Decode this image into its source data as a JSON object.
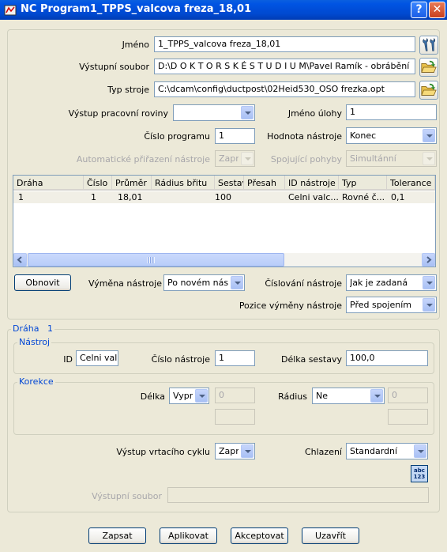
{
  "window": {
    "title": "NC Program1_TPPS_valcova freza_18,01",
    "help_label": "?",
    "close_label": "✕"
  },
  "form": {
    "name_label": "Jméno",
    "name_value": "1_TPPS_valcova freza_18,01",
    "output_file_label": "Výstupní soubor",
    "output_file_value": "D:\\D O K T O R S K É     S T U D I U M\\Pavel Ramík - obrábění",
    "machine_type_label": "Typ stroje",
    "machine_type_value": "C:\\dcam\\config\\ductpost\\02Heid530_OSO frezka.opt",
    "work_plane_label": "Výstup pracovní roviny",
    "work_plane_value": "",
    "task_name_label": "Jméno úlohy",
    "task_name_value": "1",
    "program_number_label": "Číslo programu",
    "program_number_value": "1",
    "tool_value_label": "Hodnota nástroje",
    "tool_value_value": "Konec",
    "auto_tool_assign_label": "Automatické přiřazení nástroje",
    "auto_tool_assign_value": "Zapnout",
    "connecting_moves_label": "Spojující pohyby",
    "connecting_moves_value": "Simultánní"
  },
  "table": {
    "columns": [
      "Dráha",
      "Číslo",
      "Průměr",
      "Rádius břitu",
      "Sestava",
      "Přesah",
      "ID nástroje",
      "Typ",
      "Tolerance"
    ],
    "rows": [
      [
        "1",
        "1",
        "18,01",
        "",
        "100",
        "",
        "Celni valc...",
        "Rovné č...",
        "0,1"
      ]
    ]
  },
  "actions": {
    "refresh_label": "Obnovit",
    "tool_change_label": "Výměna nástroje",
    "tool_change_value": "Po novém nástroji",
    "tool_numbering_label": "Číslování nástroje",
    "tool_numbering_value": "Jak je zadaná",
    "tool_change_position_label": "Pozice výměny nástroje",
    "tool_change_position_value": "Před spojením"
  },
  "path": {
    "group_label": "Dráha",
    "group_number": "1",
    "tool_group_label": "Nástroj",
    "id_label": "ID",
    "id_value": "Celni valc",
    "tool_number_label": "Číslo nástroje",
    "tool_number_value": "1",
    "assembly_length_label": "Délka sestavy",
    "assembly_length_value": "100,0",
    "correction_group_label": "Korekce",
    "length_label": "Délka",
    "length_mode_value": "Vypnout",
    "length_value": "0",
    "length_extra_value": "",
    "radius_label": "Rádius",
    "radius_mode_value": "Ne",
    "radius_value": "0",
    "radius_extra_value": "",
    "drill_cycle_label": "Výstup vrtacího cyklu",
    "drill_cycle_value": "Zapnout",
    "coolant_label": "Chlazení",
    "coolant_value": "Standardní",
    "spell_icon_text": "abc 123",
    "output_file_label": "Výstupní soubor",
    "output_file_value": ""
  },
  "footer": {
    "write_label": "Zapsat",
    "apply_label": "Aplikovat",
    "accept_label": "Akceptovat",
    "close_label": "Uzavřít"
  }
}
